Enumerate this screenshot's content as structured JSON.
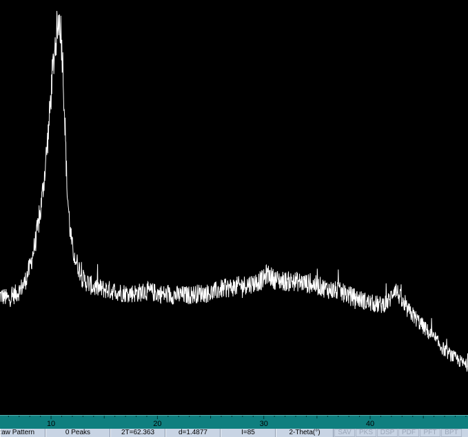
{
  "chart_data": {
    "type": "line",
    "xlabel": "",
    "ylabel": "",
    "xlim": [
      5.2,
      49.2
    ],
    "ylim": [
      0,
      100
    ],
    "x_ticks": [
      10,
      20,
      30,
      40
    ],
    "line_color": "#ffffff",
    "background": "#000000",
    "grid": false,
    "series": [
      {
        "x": [
          5.2,
          6.0,
          7.0,
          7.5,
          8.0,
          8.5,
          9.0,
          9.4,
          9.8,
          10.1,
          10.4,
          10.6,
          10.75,
          10.9,
          11.1,
          11.3,
          11.5,
          11.8,
          12.0,
          12.3,
          12.6,
          13.0,
          13.5,
          14.0,
          15.0,
          16.0,
          17.0,
          18.0,
          19.0,
          20.0,
          21.0,
          22.0,
          23.0,
          24.0,
          25.0,
          25.5,
          26.0,
          27.0,
          28.0,
          29.0,
          30.0,
          30.3,
          31.0,
          32.0,
          33.0,
          34.0,
          35.0,
          36.0,
          37.0,
          38.0,
          39.0,
          40.0,
          41.0,
          41.8,
          42.3,
          42.7,
          43.2,
          44.0,
          45.0,
          46.0,
          47.0,
          48.0,
          49.2
        ],
        "y": [
          29,
          28,
          30,
          32,
          36,
          42,
          50,
          60,
          72,
          84,
          93,
          97,
          99,
          97,
          88,
          73,
          56,
          45,
          41,
          38,
          36,
          33,
          32,
          31,
          30.5,
          30,
          29.5,
          29.5,
          30,
          29.5,
          29,
          29,
          29,
          29.5,
          29.5,
          30,
          30.5,
          31,
          31.5,
          32,
          33,
          34.5,
          33,
          32.5,
          32.5,
          32,
          31.5,
          30.5,
          30,
          29,
          28,
          27,
          26.5,
          27.5,
          31,
          29,
          26,
          24,
          21,
          18,
          15,
          13,
          11
        ]
      }
    ]
  },
  "status": {
    "mode": "Raw Pattern",
    "peaks": "0 Peaks",
    "two_theta": "2T=62.363",
    "d_spacing": "d=1.4877",
    "intensity": "I=85",
    "axis_unit": "2-Theta(°)",
    "buttons": [
      "SAV",
      "PKS",
      "DSP",
      "PDF",
      "PFT",
      "BPT"
    ]
  }
}
